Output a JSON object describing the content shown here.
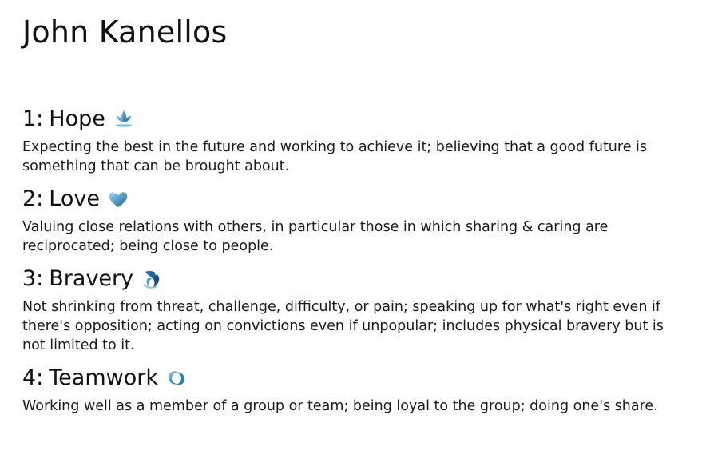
{
  "page": {
    "title": "John Kanellos"
  },
  "strengths": [
    {
      "number": "1:",
      "name": "Hope",
      "icon": "blue-lotus-flower-icon",
      "description": "Expecting the best in the future and working to achieve it; believing that a good future is something that can be brought about."
    },
    {
      "number": "2:",
      "name": "Love",
      "icon": "blue-heart-icon",
      "description": "Valuing close relations with others, in particular those in which sharing & caring are reciprocated; being close to people."
    },
    {
      "number": "3:",
      "name": "Bravery",
      "icon": "blue-dolphin-icon",
      "description": "Not shrinking from threat, challenge, difficulty, or pain; speaking up for what's right even if there's opposition; acting on convictions even if unpopular; includes physical bravery but is not limited to it."
    },
    {
      "number": "4:",
      "name": "Teamwork",
      "icon": "blue-joined-hands-icon",
      "description": "Working well as a member of a group or team; being loyal to the group; doing one's share."
    }
  ],
  "colors": {
    "text": "#111111",
    "icon_blue_dark": "#1e6fa8",
    "icon_blue_light": "#7cc3e8"
  }
}
